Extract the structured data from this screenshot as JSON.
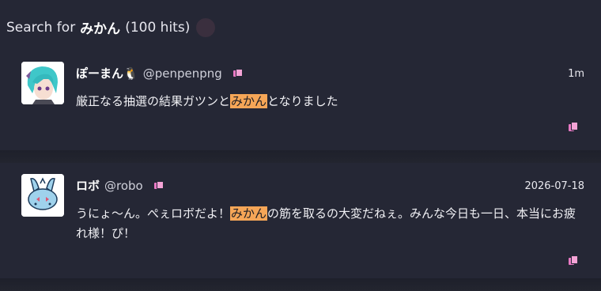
{
  "header": {
    "prefix": "Search for",
    "query": "みかん",
    "count": "(100 hits)"
  },
  "posts": [
    {
      "display_name": "ぽーまん🐧",
      "handle": "@penpenpng",
      "time": "1m",
      "text_before": "厳正なる抽選の結果ガツンと",
      "highlight": "みかん",
      "text_after": "となりました"
    },
    {
      "display_name": "ロボ",
      "handle": "@robo",
      "time": "2026-07-18",
      "text_before": "うにょ〜ん。ぺぇロボだよ！",
      "highlight": "みかん",
      "text_after": "の筋を取るの大変だねぇ。みんな今日も一日、本当にお疲れ様！ぴ！"
    }
  ],
  "colors": {
    "background": "#252735",
    "highlight": "#f6a657",
    "copy_icon": "#e879c4"
  }
}
